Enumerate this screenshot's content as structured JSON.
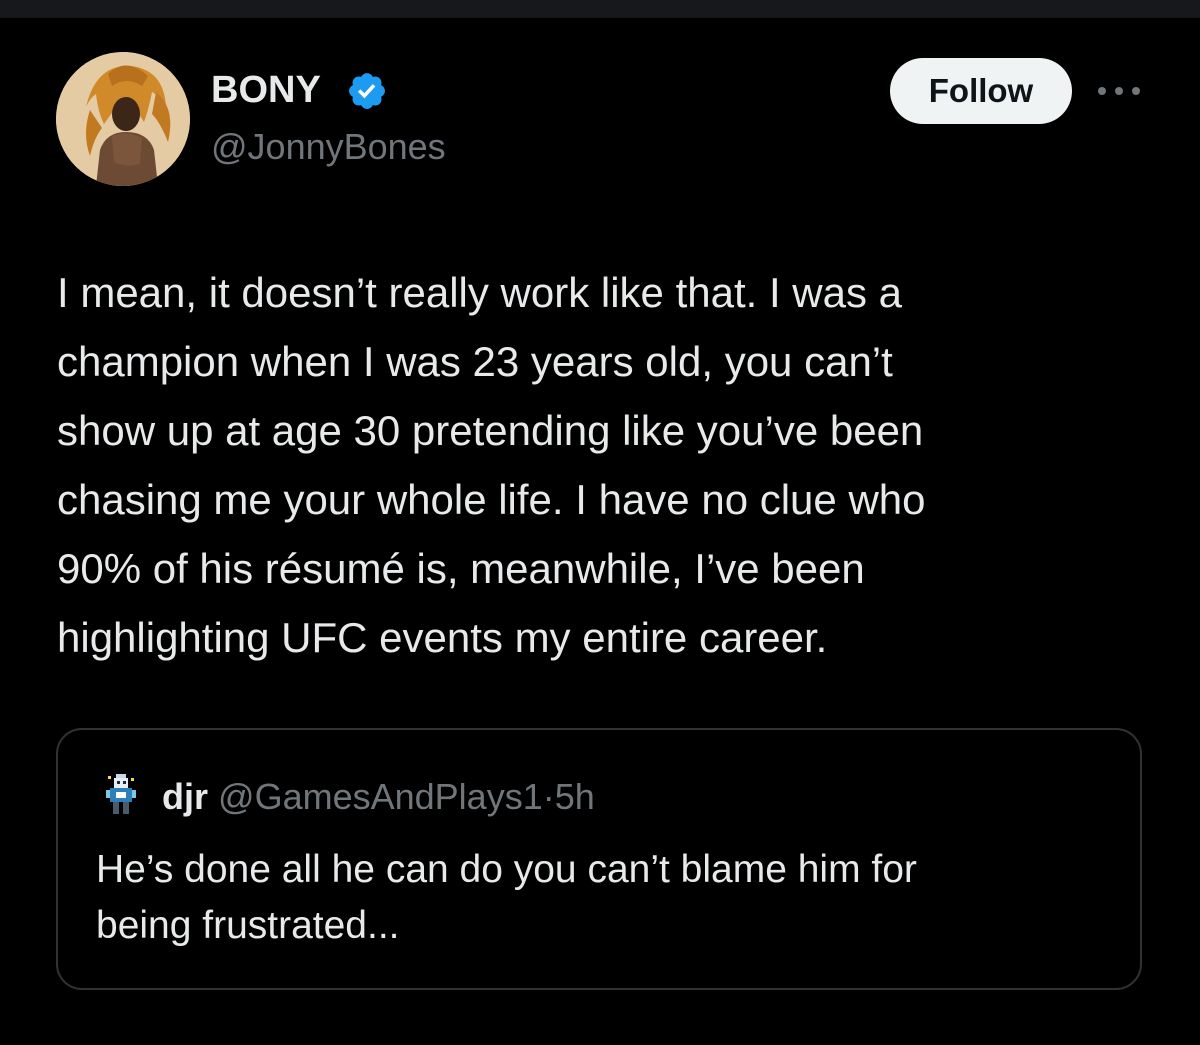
{
  "author": {
    "display_name": "BONY",
    "handle": "@JonnyBones",
    "avatar_icon": "lion-headdress-avatar",
    "verified": true,
    "verified_color": "#1d9bf0"
  },
  "header": {
    "follow_label": "Follow",
    "more_icon": "ellipsis-icon"
  },
  "tweet": {
    "text": "I mean, it doesn’t really work like that. I was a\nchampion when I was 23 years old, you can’t\nshow up at age 30 pretending like you’ve been\nchasing me your whole life. I have no clue who\n90% of his résumé is, meanwhile, I’ve been\nhighlighting UFC events my entire career."
  },
  "quote": {
    "name": "djr",
    "handle": "@GamesAndPlays1",
    "separator": "·",
    "time": "5h",
    "avatar_icon": "pixel-character-avatar",
    "text": "He’s done all he can do you can’t blame him for\nbeing frustrated..."
  },
  "colors": {
    "background": "#000000",
    "primary_text": "#e7e9ea",
    "secondary_text": "#71767b",
    "border": "#2f3336",
    "button_bg": "#eff3f4"
  }
}
